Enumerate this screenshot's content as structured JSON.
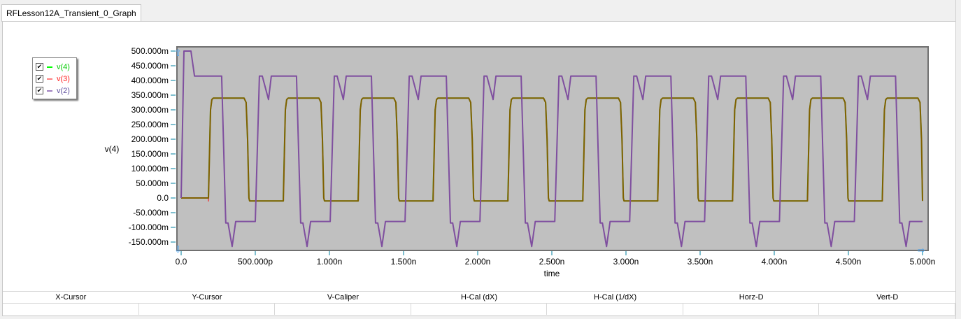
{
  "tab": {
    "label": "RFLesson12A_Transient_0_Graph"
  },
  "legend": [
    {
      "label": "v(4)",
      "color": "#00cc00",
      "checked": "✔"
    },
    {
      "label": "v(3)",
      "color": "#ff2020",
      "checked": "✔"
    },
    {
      "label": "v(2)",
      "color": "#7f4f9f",
      "checked": "✔"
    }
  ],
  "cursor_table": {
    "headers": [
      "X-Cursor",
      "Y-Cursor",
      "V-Caliper",
      "H-Cal (dX)",
      "H-Cal (1/dX)",
      "Horz-D",
      "Vert-D"
    ]
  },
  "chart_data": {
    "type": "line",
    "xlabel": "time",
    "ylabel": "v(4)",
    "xlim": [
      0,
      5
    ],
    "ylim": [
      -165,
      505
    ],
    "x_unit": "ns",
    "y_unit": "mV",
    "xticks": [
      0,
      0.5,
      1,
      1.5,
      2,
      2.5,
      3,
      3.5,
      4,
      4.5,
      5
    ],
    "xtick_labels": [
      "0.0",
      "500.000p",
      "1.000n",
      "1.500n",
      "2.000n",
      "2.500n",
      "3.000n",
      "3.500n",
      "4.000n",
      "4.500n",
      "5.000n"
    ],
    "yticks": [
      500,
      450,
      400,
      350,
      300,
      250,
      200,
      150,
      100,
      50,
      0,
      -50,
      -100,
      -150
    ],
    "ytick_labels": [
      "500.000m",
      "450.000m",
      "400.000m",
      "350.000m",
      "300.000m",
      "250.000m",
      "200.000m",
      "150.000m",
      "100.000m",
      "50.000m",
      "0.0",
      "-50.000m",
      "-100.000m",
      "-150.000m"
    ],
    "period_ns": 0.505,
    "first_edge_ns": 0.193,
    "cycles": 10,
    "series": [
      {
        "name": "v(4)",
        "color": "#00c000",
        "initial_points": [
          [
            0,
            0
          ],
          [
            0.184,
            0
          ]
        ],
        "cycle_points": [
          [
            -0.009,
            0
          ],
          [
            0.005,
            300
          ],
          [
            0.014,
            335
          ],
          [
            0.024,
            340
          ],
          [
            0.231,
            340
          ],
          [
            0.245,
            325
          ],
          [
            0.255,
            200
          ],
          [
            0.264,
            0
          ],
          [
            0.269,
            -10
          ],
          [
            0.496,
            -10
          ]
        ],
        "end_value": -10
      },
      {
        "name": "v(3)",
        "color": "#ff0000",
        "initial_points": [
          [
            0,
            0
          ],
          [
            0.184,
            0
          ]
        ],
        "cycle_points": [
          [
            -0.009,
            -10
          ],
          [
            0.005,
            300
          ],
          [
            0.014,
            335
          ],
          [
            0.024,
            340
          ],
          [
            0.231,
            340
          ],
          [
            0.245,
            325
          ],
          [
            0.255,
            200
          ],
          [
            0.264,
            0
          ],
          [
            0.269,
            -10
          ],
          [
            0.496,
            -10
          ]
        ],
        "end_value": -10
      },
      {
        "name": "v(2)",
        "color": "#7f4f9f",
        "initial_points": [
          [
            0,
            0
          ],
          [
            0.019,
            500
          ],
          [
            0.066,
            500
          ],
          [
            0.09,
            415
          ]
        ],
        "cycle_points": [
          [
            0.08,
            415
          ],
          [
            0.108,
            -85
          ],
          [
            0.123,
            -85
          ],
          [
            0.151,
            -165
          ],
          [
            0.175,
            -80
          ],
          [
            0.307,
            -80
          ],
          [
            0.335,
            415
          ],
          [
            0.354,
            415
          ],
          [
            0.396,
            335
          ],
          [
            0.415,
            415
          ],
          [
            0.585,
            415
          ]
        ],
        "end_value": -80
      }
    ]
  }
}
